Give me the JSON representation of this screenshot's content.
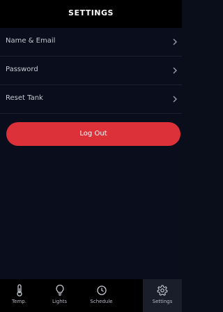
{
  "header": {
    "title": "SETTINGS"
  },
  "settings": {
    "items": [
      {
        "label": "Name & Email"
      },
      {
        "label": "Password"
      },
      {
        "label": "Reset Tank"
      }
    ],
    "logout_label": "Log Out"
  },
  "tabs": [
    {
      "label": "Temp.",
      "icon": "thermometer-icon"
    },
    {
      "label": "Lights",
      "icon": "lightbulb-icon"
    },
    {
      "label": "Schedule",
      "icon": "clock-icon"
    },
    {
      "label": "Settings",
      "icon": "gear-icon"
    }
  ],
  "colors": {
    "background": "#0a0d1c",
    "header": "#000000",
    "accent": "#dc3138",
    "text": "#c7c9d1",
    "active_tab": "#1a1d2a"
  }
}
